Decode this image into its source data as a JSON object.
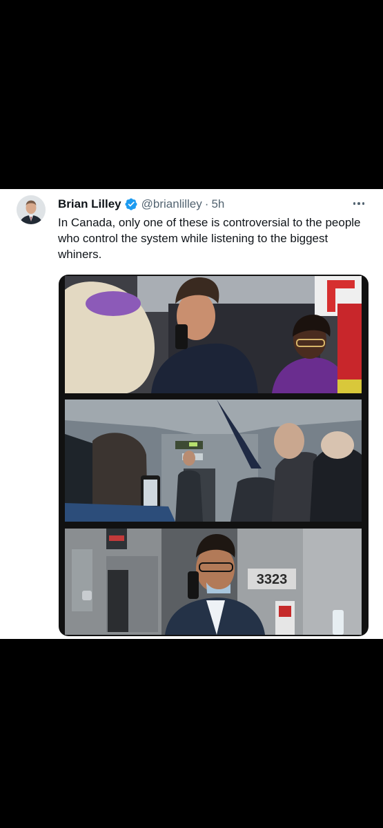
{
  "tweet": {
    "author_name": "Brian Lilley",
    "handle": "@brianlilley",
    "separator": "·",
    "time": "5h",
    "text": "In Canada, only one of these is controversial to the people who control the system while listening to the biggest whiners.",
    "more_icon": "more-horizontal-icon",
    "verified_icon": "verified-badge-icon",
    "verified_color": "#1d9bf0"
  },
  "media": {
    "panels": [
      {
        "name": "video-still-1"
      },
      {
        "name": "video-still-2"
      },
      {
        "name": "video-still-3",
        "door_number": "3323"
      }
    ]
  }
}
